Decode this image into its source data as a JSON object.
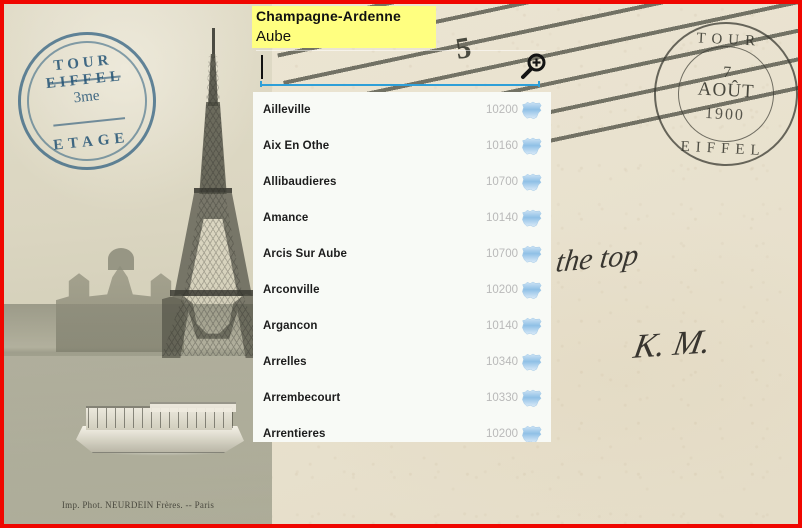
{
  "header": {
    "region": "Champagne-Ardenne",
    "department": "Aube"
  },
  "search": {
    "value": "",
    "placeholder": "",
    "zoom_icon": "magnifier-plus-icon",
    "underline_color": "#2e9fd8"
  },
  "colors": {
    "highlight": "#ffff80",
    "frame": "#f00600",
    "panel": "#f8faf6",
    "code_text": "#b9b9b9",
    "name_text": "#1c1c1c"
  },
  "list": {
    "icon": "france-map-icon",
    "items": [
      {
        "name": "Ailleville",
        "code": "10200"
      },
      {
        "name": "Aix En Othe",
        "code": "10160"
      },
      {
        "name": "Allibaudieres",
        "code": "10700"
      },
      {
        "name": "Amance",
        "code": "10140"
      },
      {
        "name": "Arcis Sur Aube",
        "code": "10700"
      },
      {
        "name": "Arconville",
        "code": "10200"
      },
      {
        "name": "Argancon",
        "code": "10140"
      },
      {
        "name": "Arrelles",
        "code": "10340"
      },
      {
        "name": "Arrembecourt",
        "code": "10330"
      },
      {
        "name": "Arrentieres",
        "code": "10200"
      }
    ]
  },
  "background": {
    "photo_caption": "Imp. Phot. NEURDEIN Frères. -- Paris",
    "stamp_eiffel": {
      "top": "TOUR EIFFEL",
      "middle": "3me",
      "bottom": "ETAGE"
    },
    "stamp_tour": {
      "top": "TOUR",
      "bottom": "EIFFEL",
      "day": "7",
      "month": "AOÛT",
      "year": "1900"
    },
    "cancel_number": "5",
    "handwriting_line1": "the top",
    "handwriting_line2": "K. M."
  }
}
